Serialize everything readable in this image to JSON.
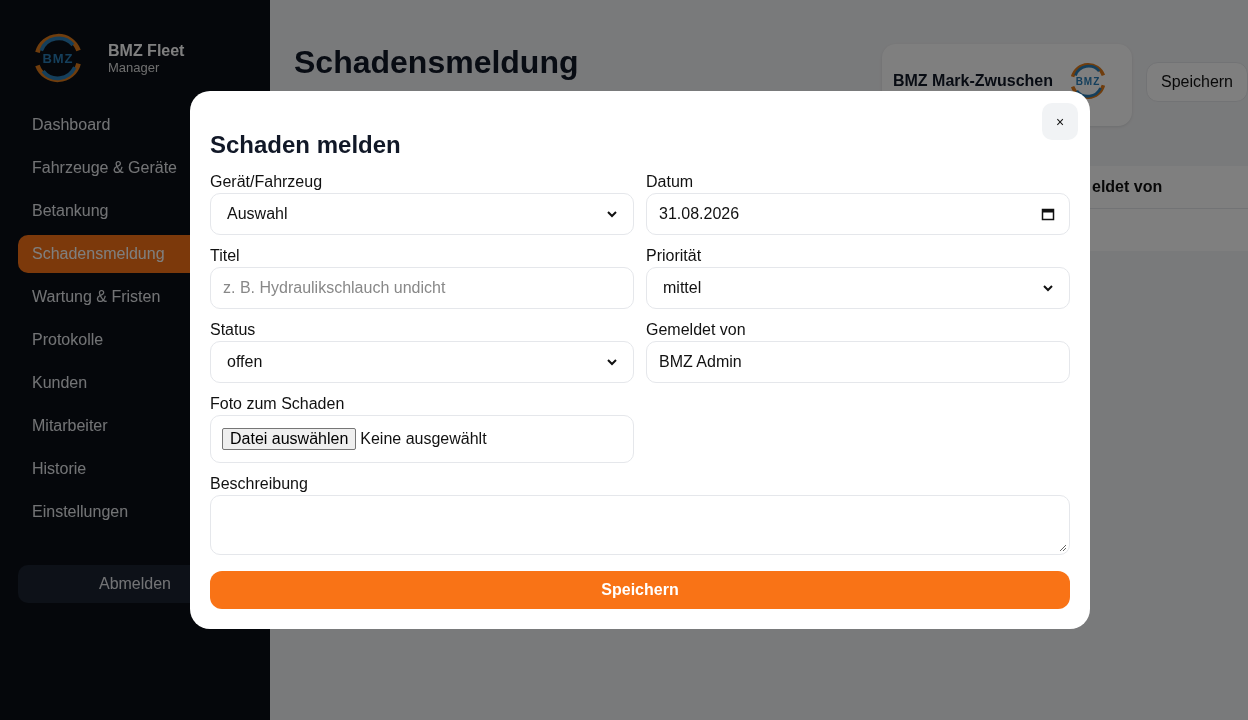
{
  "sidebar": {
    "logo_text": "BMZ",
    "brand": "BMZ Fleet",
    "subtitle": "Manager",
    "items": [
      {
        "label": "Dashboard",
        "selected": false
      },
      {
        "label": "Fahrzeuge & Geräte",
        "selected": false
      },
      {
        "label": "Betankung",
        "selected": false
      },
      {
        "label": "Schadensmeldung",
        "selected": true
      },
      {
        "label": "Wartung & Fristen",
        "selected": false
      },
      {
        "label": "Protokolle",
        "selected": false
      },
      {
        "label": "Kunden",
        "selected": false
      },
      {
        "label": "Mitarbeiter",
        "selected": false
      },
      {
        "label": "Historie",
        "selected": false
      },
      {
        "label": "Einstellungen",
        "selected": false
      }
    ],
    "logout": "Abmelden"
  },
  "page": {
    "title": "Schadensmeldung",
    "company": {
      "name": "BMZ Mark-Zwuschen",
      "logo_text": "BMZ"
    },
    "save_button": "Speichern",
    "table": {
      "columns": [
        "eldet von"
      ]
    }
  },
  "modal": {
    "title": "Schaden melden",
    "close": "×",
    "fields": [
      {
        "kind": "select",
        "label": "Gerät/Fahrzeug",
        "value": "Auswahl"
      },
      {
        "kind": "date",
        "label": "Datum",
        "value": "31.08.2026"
      },
      {
        "kind": "text",
        "label": "Titel",
        "placeholder": "z. B. Hydraulikschlauch undicht"
      },
      {
        "kind": "select",
        "label": "Priorität",
        "value": "mittel"
      },
      {
        "kind": "select",
        "label": "Status",
        "value": "offen"
      },
      {
        "kind": "text",
        "label": "Gemeldet von",
        "value": "BMZ Admin"
      },
      {
        "kind": "file",
        "label": "Foto zum Schaden",
        "button": "Datei auswählen",
        "status": "Keine ausgewählt"
      },
      {
        "kind": "textarea",
        "label": "Beschreibung"
      }
    ],
    "submit": "Speichern"
  }
}
